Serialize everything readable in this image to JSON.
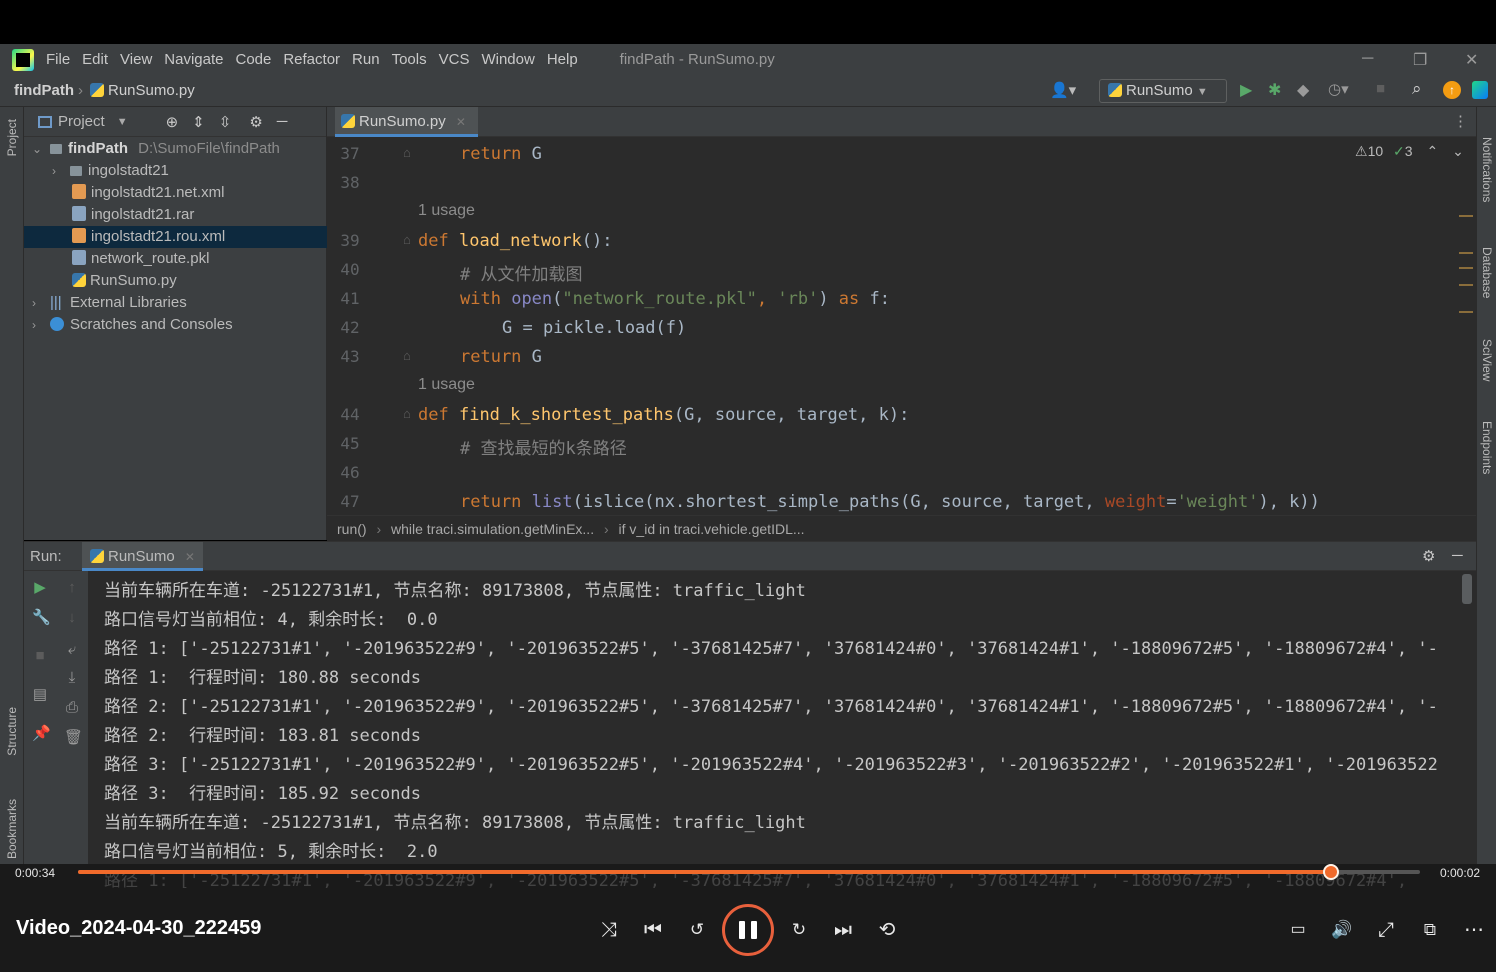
{
  "menubar": {
    "items": [
      "File",
      "Edit",
      "View",
      "Navigate",
      "Code",
      "Refactor",
      "Run",
      "Tools",
      "VCS",
      "Window",
      "Help"
    ],
    "window_title": "findPath - RunSumo.py"
  },
  "navbar": {
    "project": "findPath",
    "file": "RunSumo.py",
    "run_config": "RunSumo"
  },
  "left_strip": {
    "project": "Project",
    "structure": "Structure",
    "bookmarks": "Bookmarks"
  },
  "right_strip": {
    "notifications": "Notifications",
    "database": "Database",
    "sciview": "SciView",
    "endpoints": "Endpoints"
  },
  "project_panel": {
    "title": "Project",
    "root_name": "findPath",
    "root_path": "D:\\SumoFile\\findPath",
    "items": [
      {
        "label": "ingolstadt21"
      },
      {
        "label": "ingolstadt21.net.xml"
      },
      {
        "label": "ingolstadt21.rar"
      },
      {
        "label": "ingolstadt21.rou.xml"
      },
      {
        "label": "network_route.pkl"
      },
      {
        "label": "RunSumo.py"
      },
      {
        "label": "External Libraries"
      },
      {
        "label": "Scratches and Consoles"
      }
    ]
  },
  "editor": {
    "tab": "RunSumo.py",
    "warnings": "10",
    "weak_warnings": "3",
    "line_numbers": [
      "37",
      "38",
      "39",
      "40",
      "41",
      "42",
      "43",
      "44",
      "45",
      "46",
      "47"
    ],
    "usage_hint": "1 usage",
    "code": {
      "l37": [
        "return",
        " G"
      ],
      "l39": [
        "def",
        " ",
        "load_network",
        "():"
      ],
      "l40": "# 从文件加载图",
      "l41": [
        "with",
        " ",
        "open",
        "(",
        "\"network_route.pkl\"",
        ", ",
        "'rb'",
        ") ",
        "as",
        " f:"
      ],
      "l42": "G = pickle.load(f)",
      "l43": [
        "return",
        " G"
      ],
      "l44": [
        "def",
        " ",
        "find_k_shortest_paths",
        "(G",
        ", source",
        ", target",
        ", k):"
      ],
      "l45": "# 查找最短的k条路径",
      "l47": [
        "return",
        " ",
        "list",
        "(islice(nx.shortest_simple_paths(G",
        ", source",
        ", target",
        ", ",
        "weight",
        "=",
        "'weight'",
        ")",
        ", k))"
      ]
    },
    "breadcrumb": [
      "run()",
      "while traci.simulation.getMinEx...",
      "if v_id in traci.vehicle.getIDL..."
    ]
  },
  "run_panel": {
    "label": "Run:",
    "tab": "RunSumo",
    "lines": [
      "当前车辆所在车道: -25122731#1, 节点名称: 89173808, 节点属性: traffic_light",
      "路口信号灯当前相位: 4, 剩余时长:  0.0",
      "路径 1: ['-25122731#1', '-201963522#9', '-201963522#5', '-37681425#7', '37681424#0', '37681424#1', '-18809672#5', '-18809672#4', '-",
      "路径 1:  行程时间: 180.88 seconds",
      "路径 2: ['-25122731#1', '-201963522#9', '-201963522#5', '-37681425#7', '37681424#0', '37681424#1', '-18809672#5', '-18809672#4', '-",
      "路径 2:  行程时间: 183.81 seconds",
      "路径 3: ['-25122731#1', '-201963522#9', '-201963522#5', '-201963522#4', '-201963522#3', '-201963522#2', '-201963522#1', '-201963522",
      "路径 3:  行程时间: 185.92 seconds",
      "当前车辆所在车道: -25122731#1, 节点名称: 89173808, 节点属性: traffic_light",
      "路口信号灯当前相位: 5, 剩余时长:  2.0",
      "路径 1: ['-25122731#1', '-201963522#9', '-201963522#5', '-37681425#7', '37681424#0', '37681424#1', '-18809672#5', '-18809672#4', '-"
    ]
  },
  "player": {
    "title": "Video_2024-04-30_222459",
    "elapsed": "0:00:34",
    "remaining": "0:00:02",
    "progress_fraction": 0.934,
    "accent": "#f06a2b"
  }
}
